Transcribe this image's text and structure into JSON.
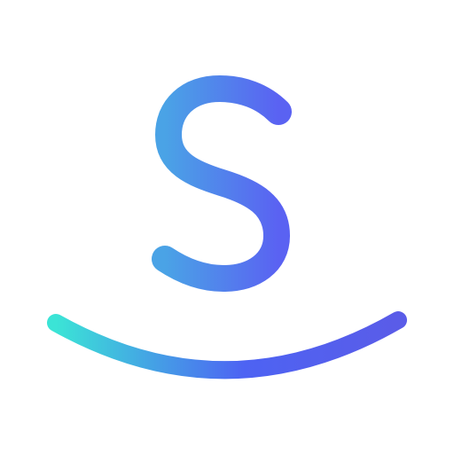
{
  "logo": {
    "letter": "S",
    "symbol": "+",
    "icon": "smile-arc-icon",
    "colors": {
      "background": "#ffffff",
      "letter_gradient_start": "#4aa3e6",
      "letter_gradient_end": "#5a62f2",
      "plus_gradient_start": "#4b8fec",
      "plus_gradient_end": "#5a5ef2",
      "arc_gradient_start": "#3be4d6",
      "arc_gradient_mid": "#4d63f3",
      "arc_gradient_end": "#5a5ce8"
    }
  }
}
